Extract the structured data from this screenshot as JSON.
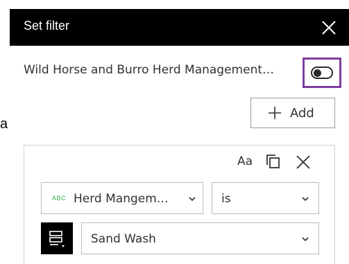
{
  "stray_text": "a",
  "panel": {
    "title": "Set filter",
    "close_icon": "close-icon"
  },
  "layer": {
    "label": "Wild Horse and Burro Herd Management…",
    "toggle_on": false
  },
  "add_button": {
    "label": "Add",
    "icon": "plus-icon"
  },
  "filter": {
    "case_sensitive_label": "Aa",
    "duplicate_icon": "duplicate-icon",
    "remove_icon": "close-icon",
    "field": {
      "type_badge": "ABC",
      "label": "Herd Mangem…"
    },
    "operator": {
      "label": "is"
    },
    "value_mode_icon": "unique-values-list-icon",
    "value": {
      "label": "Sand Wash"
    }
  },
  "colors": {
    "header_bg": "#000000",
    "focus_outline": "#7d3d9e",
    "text_badge": "#35ac46"
  }
}
